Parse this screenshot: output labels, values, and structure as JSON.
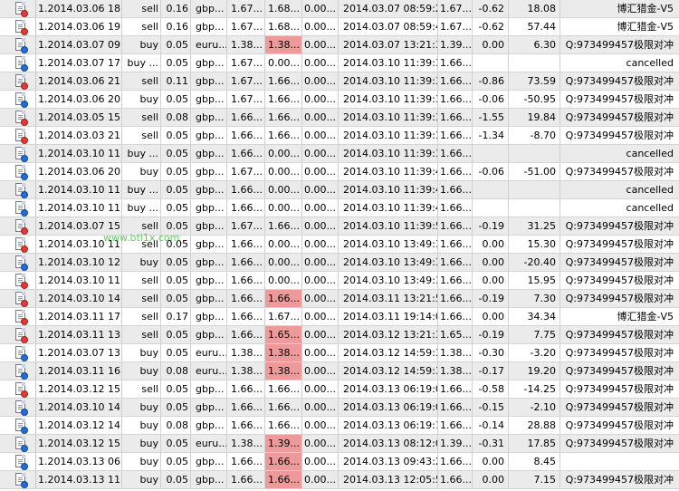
{
  "watermark": "www.btl1x.com",
  "colors": {
    "row_alt": "#ebebeb",
    "highlight": "#ef9a9a",
    "dot_red": "#e53935",
    "dot_blue": "#1e6fd9"
  },
  "rows": [
    {
      "dot": "red",
      "open": "1.2014.03.06 18:...",
      "type": "sell",
      "size": "0.16",
      "symbol": "gbp...",
      "price": "1.67...",
      "sl": "1.68...",
      "tp": "0.00...",
      "close": "2014.03.07 08:59:28",
      "cprice": "1.67...",
      "comm": "-0.62",
      "profit": "18.08",
      "comment": "博汇猎金-V5",
      "hl": false
    },
    {
      "dot": "red",
      "open": "1.2014.03.06 19:...",
      "type": "sell",
      "size": "0.16",
      "symbol": "gbp...",
      "price": "1.67...",
      "sl": "1.68...",
      "tp": "0.00...",
      "close": "2014.03.07 08:59:44",
      "cprice": "1.67...",
      "comm": "-0.62",
      "profit": "57.44",
      "comment": "博汇猎金-V5",
      "hl": false
    },
    {
      "dot": "blue",
      "open": "1.2014.03.07 09:...",
      "type": "buy",
      "size": "0.05",
      "symbol": "euru...",
      "price": "1.38...",
      "sl": "1.38...",
      "tp": "0.00...",
      "close": "2014.03.07 13:21:32",
      "cprice": "1.39...",
      "comm": "0.00",
      "profit": "6.30",
      "comment": "Q:973499457极限对冲",
      "hl": true
    },
    {
      "dot": "blue",
      "open": "1.2014.03.07 17:...",
      "type": "buy ...",
      "size": "0.05",
      "symbol": "gbp...",
      "price": "1.67...",
      "sl": "0.00...",
      "tp": "0.00...",
      "close": "2014.03.10 11:39:30",
      "cprice": "1.66...",
      "comm": "",
      "profit": "",
      "comment": "cancelled",
      "hl": false
    },
    {
      "dot": "red",
      "open": "1.2014.03.06 21:...",
      "type": "sell",
      "size": "0.11",
      "symbol": "gbp...",
      "price": "1.67...",
      "sl": "1.66...",
      "tp": "0.00...",
      "close": "2014.03.10 11:39:32",
      "cprice": "1.66...",
      "comm": "-0.86",
      "profit": "73.59",
      "comment": "Q:973499457极限对冲",
      "hl": false
    },
    {
      "dot": "blue",
      "open": "1.2014.03.06 20:...",
      "type": "buy",
      "size": "0.05",
      "symbol": "gbp...",
      "price": "1.67...",
      "sl": "1.66...",
      "tp": "0.00...",
      "close": "2014.03.10 11:39:34",
      "cprice": "1.66...",
      "comm": "-0.06",
      "profit": "-50.95",
      "comment": "Q:973499457极限对冲",
      "hl": false
    },
    {
      "dot": "red",
      "open": "1.2014.03.05 15:...",
      "type": "sell",
      "size": "0.08",
      "symbol": "gbp...",
      "price": "1.66...",
      "sl": "1.66...",
      "tp": "0.00...",
      "close": "2014.03.10 11:39:35",
      "cprice": "1.66...",
      "comm": "-1.55",
      "profit": "19.84",
      "comment": "Q:973499457极限对冲",
      "hl": false
    },
    {
      "dot": "red",
      "open": "1.2014.03.03 21:...",
      "type": "sell",
      "size": "0.05",
      "symbol": "gbp...",
      "price": "1.66...",
      "sl": "1.66...",
      "tp": "0.00...",
      "close": "2014.03.10 11:39:36",
      "cprice": "1.66...",
      "comm": "-1.34",
      "profit": "-8.70",
      "comment": "Q:973499457极限对冲",
      "hl": false
    },
    {
      "dot": "blue",
      "open": "1.2014.03.10 11:...",
      "type": "buy ...",
      "size": "0.05",
      "symbol": "gbp...",
      "price": "1.66...",
      "sl": "0.00...",
      "tp": "0.00...",
      "close": "2014.03.10 11:39:39",
      "cprice": "1.66...",
      "comm": "",
      "profit": "",
      "comment": "cancelled",
      "hl": false
    },
    {
      "dot": "blue",
      "open": "1.2014.03.06 20:...",
      "type": "buy",
      "size": "0.05",
      "symbol": "gbp...",
      "price": "1.67...",
      "sl": "0.00...",
      "tp": "0.00...",
      "close": "2014.03.10 11:39:42",
      "cprice": "1.66...",
      "comm": "-0.06",
      "profit": "-51.00",
      "comment": "Q:973499457极限对冲",
      "hl": false
    },
    {
      "dot": "blue",
      "open": "1.2014.03.10 11:...",
      "type": "buy ...",
      "size": "0.05",
      "symbol": "gbp...",
      "price": "1.66...",
      "sl": "0.00...",
      "tp": "0.00...",
      "close": "2014.03.10 11:39:44",
      "cprice": "1.66...",
      "comm": "",
      "profit": "",
      "comment": "cancelled",
      "hl": false
    },
    {
      "dot": "blue",
      "open": "1.2014.03.10 11:...",
      "type": "buy ...",
      "size": "0.05",
      "symbol": "gbp...",
      "price": "1.66...",
      "sl": "0.00...",
      "tp": "0.00...",
      "close": "2014.03.10 11:39:48",
      "cprice": "1.66...",
      "comm": "",
      "profit": "",
      "comment": "cancelled",
      "hl": false
    },
    {
      "dot": "red",
      "open": "1.2014.03.07 15:...",
      "type": "sell",
      "size": "0.05",
      "symbol": "gbp...",
      "price": "1.67...",
      "sl": "1.66...",
      "tp": "0.00...",
      "close": "2014.03.10 11:39:50",
      "cprice": "1.66...",
      "comm": "-0.19",
      "profit": "31.25",
      "comment": "Q:973499457极限对冲",
      "hl": false
    },
    {
      "dot": "red",
      "open": "1.2014.03.10 11:...",
      "type": "sell",
      "size": "0.05",
      "symbol": "gbp...",
      "price": "1.66...",
      "sl": "0.00...",
      "tp": "0.00...",
      "close": "2014.03.10 13:49:32",
      "cprice": "1.66...",
      "comm": "0.00",
      "profit": "15.30",
      "comment": "Q:973499457极限对冲",
      "hl": false
    },
    {
      "dot": "blue",
      "open": "1.2014.03.10 12:...",
      "type": "buy",
      "size": "0.05",
      "symbol": "gbp...",
      "price": "1.66...",
      "sl": "0.00...",
      "tp": "0.00...",
      "close": "2014.03.10 13:49:34",
      "cprice": "1.66...",
      "comm": "0.00",
      "profit": "-20.40",
      "comment": "Q:973499457极限对冲",
      "hl": false
    },
    {
      "dot": "red",
      "open": "1.2014.03.10 11:...",
      "type": "sell",
      "size": "0.05",
      "symbol": "gbp...",
      "price": "1.66...",
      "sl": "0.00...",
      "tp": "0.00...",
      "close": "2014.03.10 13:49:37",
      "cprice": "1.66...",
      "comm": "0.00",
      "profit": "15.95",
      "comment": "Q:973499457极限对冲",
      "hl": false
    },
    {
      "dot": "red",
      "open": "1.2014.03.10 14:...",
      "type": "sell",
      "size": "0.05",
      "symbol": "gbp...",
      "price": "1.66...",
      "sl": "1.66...",
      "tp": "0.00...",
      "close": "2014.03.11 13:21:56",
      "cprice": "1.66...",
      "comm": "-0.19",
      "profit": "7.30",
      "comment": "Q:973499457极限对冲",
      "hl": true
    },
    {
      "dot": "red",
      "open": "1.2014.03.11 17:...",
      "type": "sell",
      "size": "0.17",
      "symbol": "gbp...",
      "price": "1.66...",
      "sl": "1.67...",
      "tp": "0.00...",
      "close": "2014.03.11 19:14:03",
      "cprice": "1.66...",
      "comm": "0.00",
      "profit": "34.34",
      "comment": "博汇猎金-V5",
      "hl": false
    },
    {
      "dot": "red",
      "open": "1.2014.03.11 13:...",
      "type": "sell",
      "size": "0.05",
      "symbol": "gbp...",
      "price": "1.66...",
      "sl": "1.65...",
      "tp": "0.00...",
      "close": "2014.03.12 13:21:34",
      "cprice": "1.65...",
      "comm": "-0.19",
      "profit": "7.75",
      "comment": "Q:973499457极限对冲",
      "hl": true
    },
    {
      "dot": "blue",
      "open": "1.2014.03.07 13:...",
      "type": "buy",
      "size": "0.05",
      "symbol": "euru...",
      "price": "1.38...",
      "sl": "1.38...",
      "tp": "0.00...",
      "close": "2014.03.12 14:59:38",
      "cprice": "1.38...",
      "comm": "-0.30",
      "profit": "-3.20",
      "comment": "Q:973499457极限对冲",
      "hl": true
    },
    {
      "dot": "blue",
      "open": "1.2014.03.11 16:...",
      "type": "buy",
      "size": "0.08",
      "symbol": "euru...",
      "price": "1.38...",
      "sl": "1.38...",
      "tp": "0.00...",
      "close": "2014.03.12 14:59:38",
      "cprice": "1.38...",
      "comm": "-0.17",
      "profit": "19.20",
      "comment": "Q:973499457极限对冲",
      "hl": true
    },
    {
      "dot": "red",
      "open": "1.2014.03.12 15:...",
      "type": "sell",
      "size": "0.05",
      "symbol": "gbp...",
      "price": "1.66...",
      "sl": "1.66...",
      "tp": "0.00...",
      "close": "2014.03.13 06:19:06",
      "cprice": "1.66...",
      "comm": "-0.58",
      "profit": "-14.25",
      "comment": "Q:973499457极限对冲",
      "hl": false
    },
    {
      "dot": "blue",
      "open": "1.2014.03.10 14:...",
      "type": "buy",
      "size": "0.05",
      "symbol": "gbp...",
      "price": "1.66...",
      "sl": "1.66...",
      "tp": "0.00...",
      "close": "2014.03.13 06:19:09",
      "cprice": "1.66...",
      "comm": "-0.15",
      "profit": "-2.10",
      "comment": "Q:973499457极限对冲",
      "hl": false
    },
    {
      "dot": "blue",
      "open": "1.2014.03.12 14:...",
      "type": "buy",
      "size": "0.08",
      "symbol": "gbp...",
      "price": "1.66...",
      "sl": "1.66...",
      "tp": "0.00...",
      "close": "2014.03.13 06:19:13",
      "cprice": "1.66...",
      "comm": "-0.14",
      "profit": "28.88",
      "comment": "Q:973499457极限对冲",
      "hl": false
    },
    {
      "dot": "blue",
      "open": "1.2014.03.12 15:...",
      "type": "buy",
      "size": "0.05",
      "symbol": "euru...",
      "price": "1.38...",
      "sl": "1.39...",
      "tp": "0.00...",
      "close": "2014.03.13 08:12:00",
      "cprice": "1.39...",
      "comm": "-0.31",
      "profit": "17.85",
      "comment": "Q:973499457极限对冲",
      "hl": true
    },
    {
      "dot": "blue",
      "open": "1.2014.03.13 06:...",
      "type": "buy",
      "size": "0.05",
      "symbol": "gbp...",
      "price": "1.66...",
      "sl": "1.66...",
      "tp": "0.00...",
      "close": "2014.03.13 09:43:27",
      "cprice": "1.66...",
      "comm": "0.00",
      "profit": "8.45",
      "comment": "",
      "hl": true
    },
    {
      "dot": "blue",
      "open": "1.2014.03.13 11:...",
      "type": "buy",
      "size": "0.05",
      "symbol": "gbp...",
      "price": "1.66...",
      "sl": "1.66...",
      "tp": "0.00...",
      "close": "2014.03.13 12:05:55",
      "cprice": "1.66...",
      "comm": "0.00",
      "profit": "7.15",
      "comment": "Q:973499457极限对冲",
      "hl": true
    }
  ]
}
